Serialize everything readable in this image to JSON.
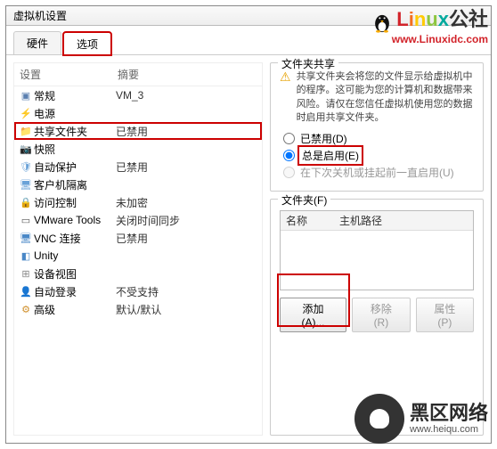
{
  "window": {
    "title": "虚拟机设置"
  },
  "tabs": {
    "hardware": "硬件",
    "options": "选项"
  },
  "deviceHeader": {
    "col1": "设置",
    "col2": "摘要"
  },
  "devices": [
    {
      "name": "常规",
      "summary": "VM_3",
      "icon": "general-icon"
    },
    {
      "name": "电源",
      "summary": "",
      "icon": "power-icon"
    },
    {
      "name": "共享文件夹",
      "summary": "已禁用",
      "icon": "shared-folder-icon",
      "highlight": true
    },
    {
      "name": "快照",
      "summary": "",
      "icon": "snapshot-icon"
    },
    {
      "name": "自动保护",
      "summary": "已禁用",
      "icon": "autoprotect-icon"
    },
    {
      "name": "客户机隔离",
      "summary": "",
      "icon": "guest-isolation-icon"
    },
    {
      "name": "访问控制",
      "summary": "未加密",
      "icon": "access-icon"
    },
    {
      "name": "VMware Tools",
      "summary": "关闭时间同步",
      "icon": "vmtools-icon"
    },
    {
      "name": "VNC 连接",
      "summary": "已禁用",
      "icon": "vnc-icon"
    },
    {
      "name": "Unity",
      "summary": "",
      "icon": "unity-icon"
    },
    {
      "name": "设备视图",
      "summary": "",
      "icon": "device-view-icon"
    },
    {
      "name": "自动登录",
      "summary": "不受支持",
      "icon": "autologin-icon"
    },
    {
      "name": "高级",
      "summary": "默认/默认",
      "icon": "advanced-icon"
    }
  ],
  "share": {
    "groupTitle": "文件夹共享",
    "warning": "共享文件夹会将您的文件显示给虚拟机中的程序。这可能为您的计算机和数据带来风险。请仅在您信任虚拟机使用您的数据时启用共享文件夹。",
    "radio_disabled": "已禁用(D)",
    "radio_always": "总是启用(E)",
    "radio_untilnext": "在下次关机或挂起前一直启用(U)"
  },
  "folders": {
    "groupTitle": "文件夹(F)",
    "col_name": "名称",
    "col_path": "主机路径"
  },
  "buttons": {
    "add": "添加(A)...",
    "remove": "移除(R)",
    "props": "属性(P)"
  },
  "watermark_top": {
    "brand": "Linux",
    "suffix": "公社",
    "url": "www.Linuxidc.com"
  },
  "watermark_bottom": {
    "text": "黑区网络",
    "url": "www.heiqu.com"
  }
}
